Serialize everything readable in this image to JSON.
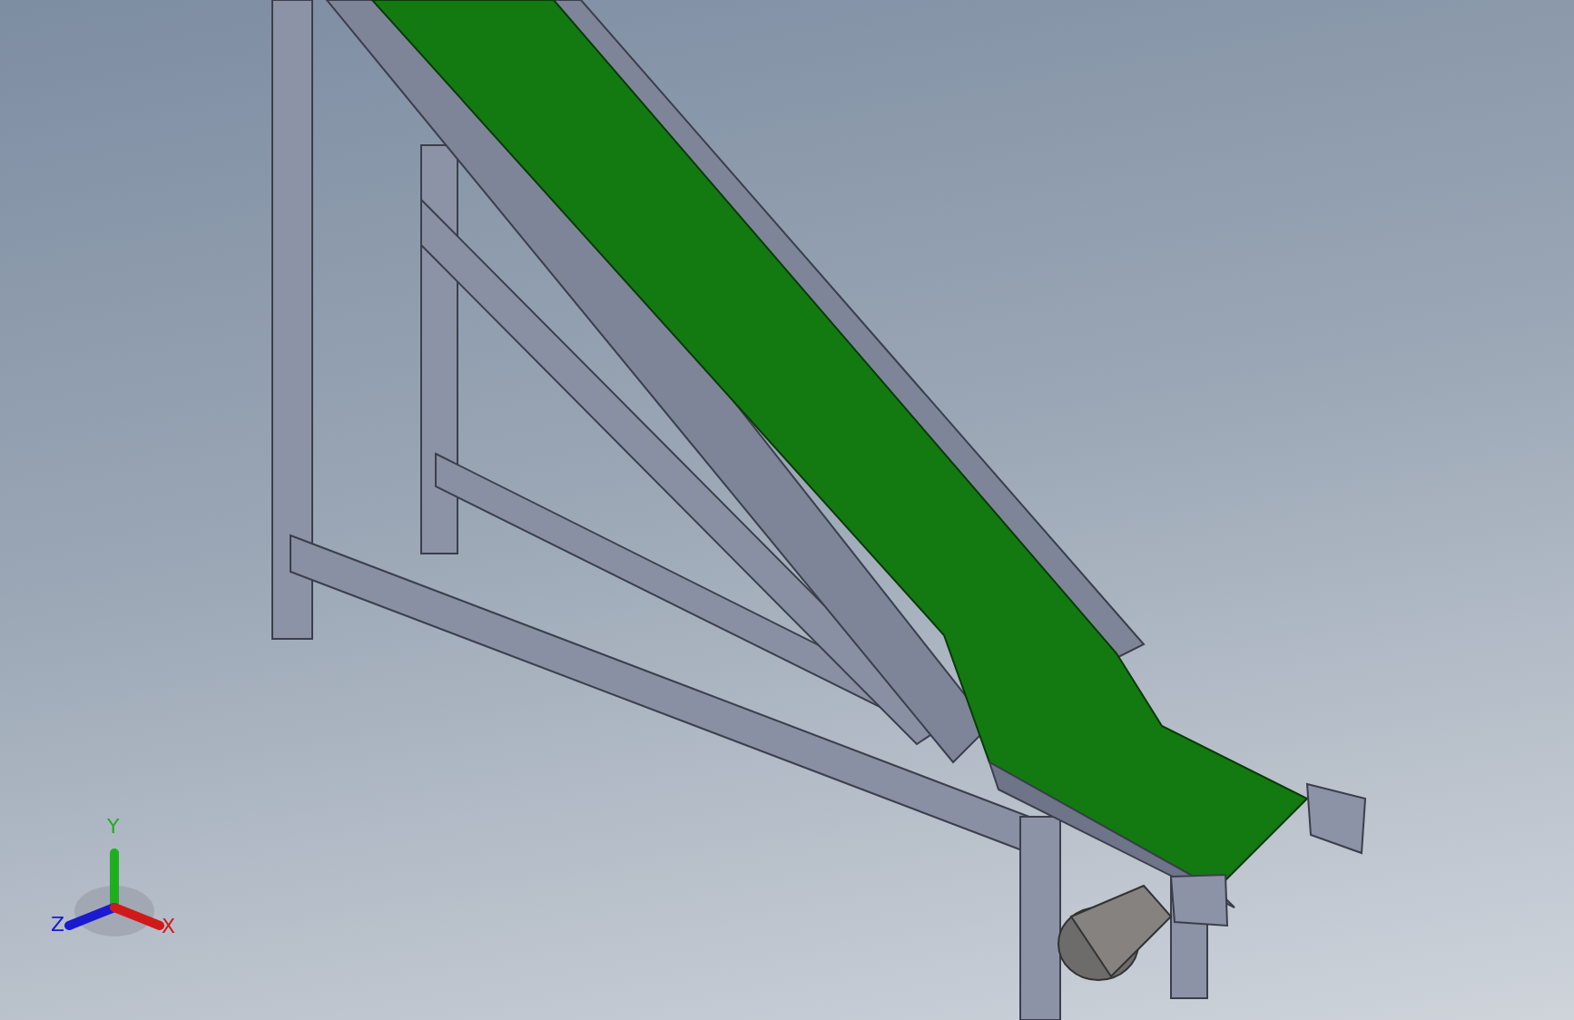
{
  "viewport": {
    "triad": {
      "axes": [
        {
          "label": "Y",
          "kind": "up",
          "color": "#1fae1f"
        },
        {
          "label": "Z",
          "kind": "left",
          "color": "#1a1ad0"
        },
        {
          "label": "X",
          "kind": "right",
          "color": "#d01a1a"
        }
      ]
    }
  }
}
